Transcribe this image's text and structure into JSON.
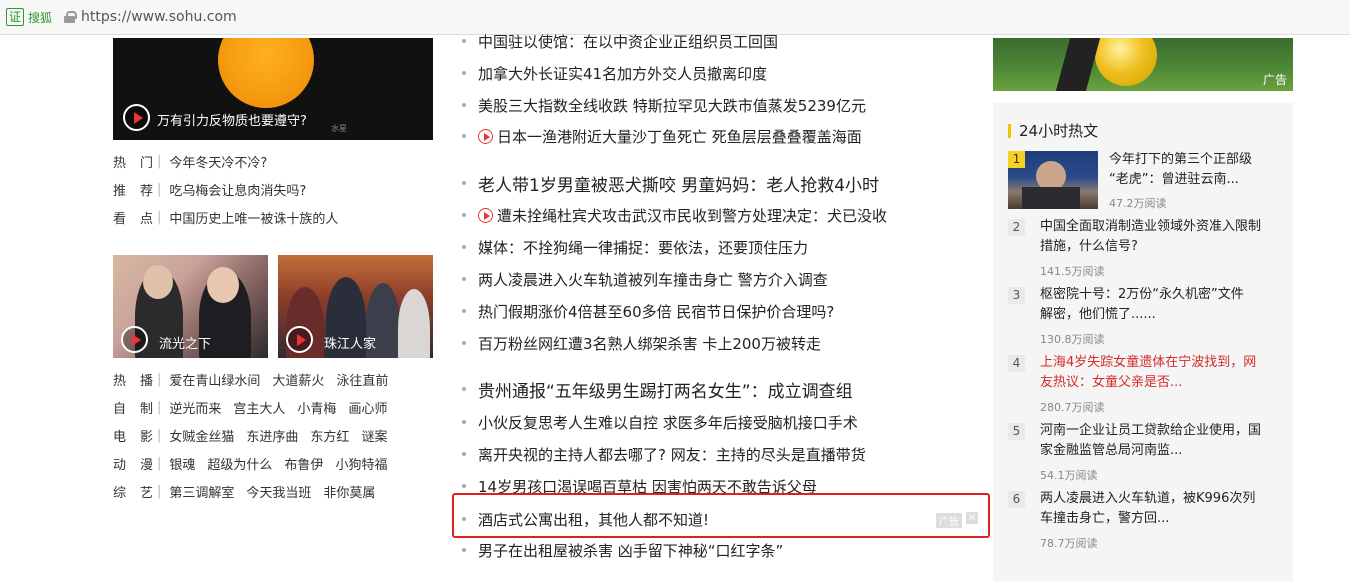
{
  "browser": {
    "badge": "证",
    "site_name": "搜狐",
    "url": "https://www.sohu.com"
  },
  "left": {
    "video1": {
      "caption": "万有引力反物质也要遵守?",
      "watermark": "水星"
    },
    "categories_top": [
      {
        "label": "热门",
        "links": [
          "今年冬天冷不冷?"
        ]
      },
      {
        "label": "推荐",
        "links": [
          "吃乌梅会让息肉消失吗?"
        ]
      },
      {
        "label": "看点",
        "links": [
          "中国历史上唯一被诛十族的人"
        ]
      }
    ],
    "thumbs": [
      {
        "caption": "流光之下"
      },
      {
        "caption": "珠江人家"
      }
    ],
    "categories_bottom": [
      {
        "label": "热播",
        "links": [
          "爱在青山绿水间",
          "大道薪火",
          "泳往直前"
        ]
      },
      {
        "label": "自制",
        "links": [
          "逆光而来",
          "宫主大人",
          "小青梅",
          "画心师"
        ]
      },
      {
        "label": "电影",
        "links": [
          "女贼金丝猫",
          "东进序曲",
          "东方红",
          "谜案"
        ]
      },
      {
        "label": "动漫",
        "links": [
          "银魂",
          "超级为什么",
          "布鲁伊",
          "小狗特福"
        ]
      },
      {
        "label": "综艺",
        "links": [
          "第三调解室",
          "今天我当班",
          "非你莫属"
        ]
      }
    ]
  },
  "news": [
    {
      "title": "中国驻以使馆：在以中资企业正组织员工回国",
      "video": false,
      "big": false
    },
    {
      "title": "加拿大外长证实41名加方外交人员撤离印度",
      "video": false,
      "big": false
    },
    {
      "title": "美股三大指数全线收跌 特斯拉罕见大跌市值蒸发5239亿元",
      "video": false,
      "big": false
    },
    {
      "title": "日本一渔港附近大量沙丁鱼死亡 死鱼层层叠叠覆盖海面",
      "video": true,
      "big": false
    },
    {
      "title": "老人带1岁男童被恶犬撕咬 男童妈妈：老人抢救4小时",
      "video": false,
      "big": true
    },
    {
      "title": "遭未拴绳杜宾犬攻击武汉市民收到警方处理决定：犬已没收",
      "video": true,
      "big": false
    },
    {
      "title": "媒体：不拴狗绳一律捕捉：要依法，还要顶住压力",
      "video": false,
      "big": false
    },
    {
      "title": "两人凌晨进入火车轨道被列车撞击身亡 警方介入调查",
      "video": false,
      "big": false
    },
    {
      "title": "热门假期涨价4倍甚至60多倍 民宿节日保护价合理吗?",
      "video": false,
      "big": false
    },
    {
      "title": "百万粉丝网红遭3名熟人绑架杀害 卡上200万被转走",
      "video": false,
      "big": false
    },
    {
      "title": "贵州通报“五年级男生踢打两名女生”：成立调查组",
      "video": false,
      "big": true
    },
    {
      "title": "小伙反复思考人生难以自控 求医多年后接受脑机接口手术",
      "video": false,
      "big": false
    },
    {
      "title": "离开央视的主持人都去哪了? 网友：主持的尽头是直播带货",
      "video": false,
      "big": false
    },
    {
      "title": "14岁男孩口渴误喝百草枯 因害怕两天不敢告诉父母",
      "video": false,
      "big": false
    },
    {
      "title": "酒店式公寓出租，其他人都不知道!",
      "video": false,
      "big": false
    },
    {
      "title": "男子在出租屋被杀害 凶手留下神秘“口红字条”",
      "video": false,
      "big": false
    }
  ],
  "ad": {
    "tag": "广告",
    "close": "×"
  },
  "right": {
    "banner_tag": "广告",
    "hot_title": "24小时热文",
    "hot": [
      {
        "rank": "1",
        "line1": "今年打下的第三个正部级",
        "line2": "“老虎”：曾进驻云南...",
        "reads": "47.2万阅读",
        "red": false
      },
      {
        "rank": "2",
        "line1": "中国全面取消制造业领域外资准入限制",
        "line2": "措施，什么信号?",
        "reads": "141.5万阅读",
        "red": false
      },
      {
        "rank": "3",
        "line1": "枢密院十号：2万份“永久机密”文件",
        "line2": "解密，他们慌了......",
        "reads": "130.8万阅读",
        "red": false
      },
      {
        "rank": "4",
        "line1": "上海4岁失踪女童遗体在宁波找到，网",
        "line2": "友热议：女童父亲是否...",
        "reads": "280.7万阅读",
        "red": true
      },
      {
        "rank": "5",
        "line1": "河南一企业让员工贷款给企业使用，国",
        "line2": "家金融监管总局河南监...",
        "reads": "54.1万阅读",
        "red": false
      },
      {
        "rank": "6",
        "line1": "两人凌晨进入火车轨道，被K996次列",
        "line2": "车撞击身亡，警方回...",
        "reads": "78.7万阅读",
        "red": false
      }
    ]
  }
}
